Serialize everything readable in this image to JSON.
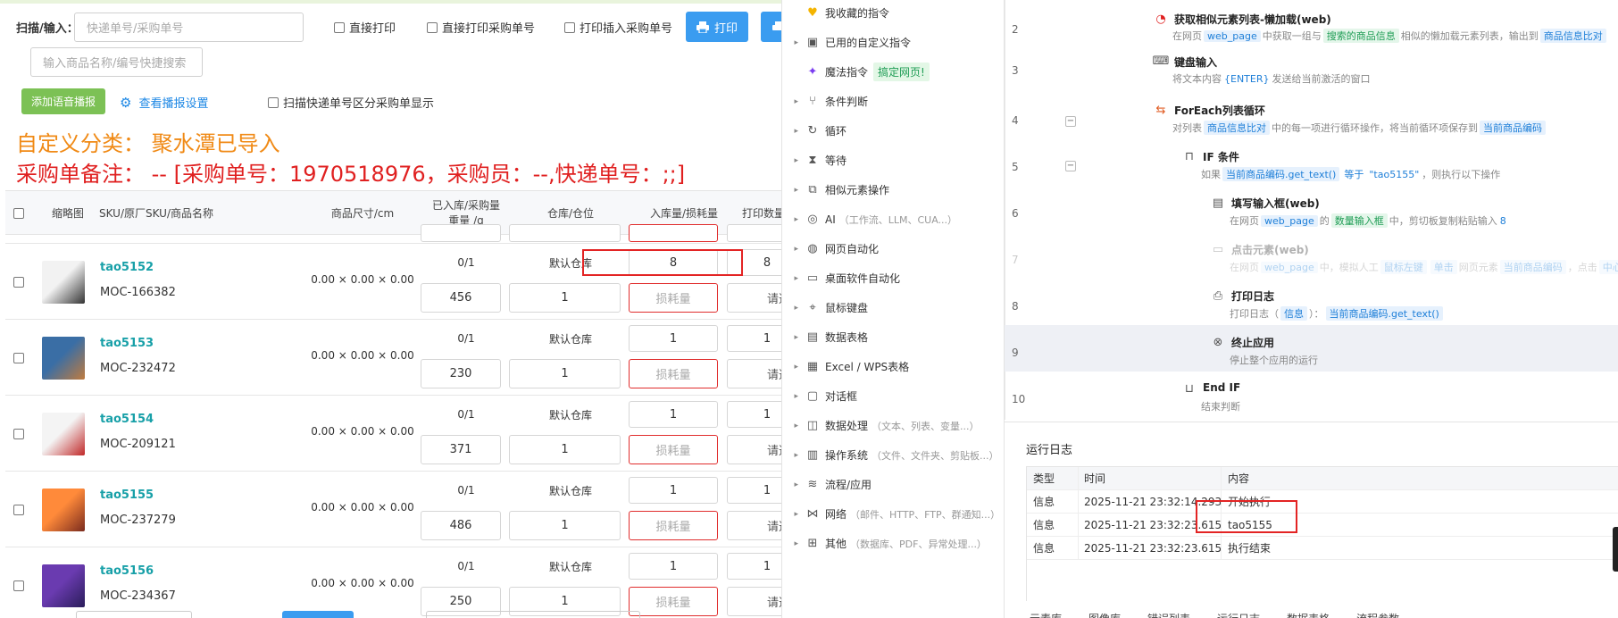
{
  "left": {
    "scan_label": "扫描/输入：",
    "scan_placeholder": "快递单号/采购单号",
    "options": [
      "直接打印",
      "直接打印采购单号",
      "打印插入采购单号"
    ],
    "print_button": "打印",
    "product_search_placeholder": "输入商品名称/编号快捷搜索",
    "voice_button": "添加语音播报",
    "voice_settings_link": "查看播报设置",
    "split_option": "扫描快递单号区分采购单显示",
    "category_line": "自定义分类： 聚水潭已导入",
    "remark_line": "采购单备注： -- [采购单号：1970518976，采购员：--,快递单号：;;]",
    "columns": [
      "缩略图",
      "SKU/原厂SKU/商品名称",
      "商品尺寸/cm",
      "已入库/采购量",
      "重量 /g",
      "仓库/仓位",
      "入库量/损耗量",
      "打印数量"
    ],
    "loss_placeholder": "损耗量",
    "print_select": "请选",
    "rows": [
      {
        "sku": "tao5152",
        "moc": "MOC-166382",
        "size": "0.00 × 0.00 × 0.00",
        "stock": "0/1",
        "weight": "456",
        "warehouse": "默认仓库",
        "pos": "1",
        "qty": "8",
        "print": "8"
      },
      {
        "sku": "tao5153",
        "moc": "MOC-232472",
        "size": "0.00 × 0.00 × 0.00",
        "stock": "0/1",
        "weight": "230",
        "warehouse": "默认仓库",
        "pos": "1",
        "qty": "1",
        "print": "1"
      },
      {
        "sku": "tao5154",
        "moc": "MOC-209121",
        "size": "0.00 × 0.00 × 0.00",
        "stock": "0/1",
        "weight": "371",
        "warehouse": "默认仓库",
        "pos": "1",
        "qty": "1",
        "print": "1"
      },
      {
        "sku": "tao5155",
        "moc": "MOC-237279",
        "size": "0.00 × 0.00 × 0.00",
        "stock": "0/1",
        "weight": "486",
        "warehouse": "默认仓库",
        "pos": "1",
        "qty": "1",
        "print": "1"
      },
      {
        "sku": "tao5156",
        "moc": "MOC-234367",
        "size": "0.00 × 0.00 × 0.00",
        "stock": "0/1",
        "weight": "250",
        "warehouse": "默认仓库",
        "pos": "1",
        "qty": "1",
        "print": "1"
      }
    ]
  },
  "commands": {
    "items": [
      {
        "label": "我收藏的指令",
        "icon": "heart-icon",
        "sub": "",
        "badge": "",
        "arrow": false
      },
      {
        "label": "已用的自定义指令",
        "icon": "custom-icon",
        "sub": "",
        "badge": "",
        "arrow": true
      },
      {
        "label": "魔法指令",
        "icon": "magic-icon",
        "sub": "",
        "badge": "搞定网页!",
        "arrow": false
      },
      {
        "label": "条件判断",
        "icon": "branch-icon",
        "sub": "",
        "badge": "",
        "arrow": true
      },
      {
        "label": "循环",
        "icon": "loop-icon",
        "sub": "",
        "badge": "",
        "arrow": true
      },
      {
        "label": "等待",
        "icon": "hourglass-icon",
        "sub": "",
        "badge": "",
        "arrow": true
      },
      {
        "label": "相似元素操作",
        "icon": "similar-icon",
        "sub": "",
        "badge": "",
        "arrow": true
      },
      {
        "label": "AI",
        "icon": "ai-icon",
        "sub": "（工作流、LLM、CUA...）",
        "badge": "",
        "arrow": true
      },
      {
        "label": "网页自动化",
        "icon": "globe-icon",
        "sub": "",
        "badge": "",
        "arrow": true
      },
      {
        "label": "桌面软件自动化",
        "icon": "monitor-icon",
        "sub": "",
        "badge": "",
        "arrow": true
      },
      {
        "label": "鼠标键盘",
        "icon": "mouse-icon",
        "sub": "",
        "badge": "",
        "arrow": true
      },
      {
        "label": "数据表格",
        "icon": "table-icon",
        "sub": "",
        "badge": "",
        "arrow": true
      },
      {
        "label": "Excel / WPS表格",
        "icon": "excel-icon",
        "sub": "",
        "badge": "",
        "arrow": true
      },
      {
        "label": "对话框",
        "icon": "dialog-icon",
        "sub": "",
        "badge": "",
        "arrow": true
      },
      {
        "label": "数据处理",
        "icon": "data-icon",
        "sub": "（文本、列表、变量...）",
        "badge": "",
        "arrow": true
      },
      {
        "label": "操作系统",
        "icon": "os-icon",
        "sub": "（文件、文件夹、剪贴板...）",
        "badge": "",
        "arrow": true
      },
      {
        "label": "流程/应用",
        "icon": "layers-icon",
        "sub": "",
        "badge": "",
        "arrow": true
      },
      {
        "label": "网络",
        "icon": "network-icon",
        "sub": "（邮件、HTTP、FTP、群通知...）",
        "badge": "",
        "arrow": true
      },
      {
        "label": "其他",
        "icon": "grid-icon",
        "sub": "（数据库、PDF、异常处理...）",
        "badge": "",
        "arrow": true
      }
    ]
  },
  "flow": {
    "steps": [
      {
        "line": "2",
        "title": "获取相似元素列表-懒加载(web)",
        "desc": [
          "在网页",
          "web_page",
          "中获取一组与",
          "搜索的商品信息",
          "相似的懒加载元素列表，输出到",
          "商品信息比对"
        ]
      },
      {
        "line": "3",
        "title": "键盘输入",
        "desc": [
          "将文本内容",
          "{ENTER}",
          "发送给当前激活的窗口"
        ]
      },
      {
        "line": "4",
        "title": "ForEach列表循环",
        "desc": [
          "对列表",
          "商品信息比对",
          "中的每一项进行循环操作，将当前循环项保存到",
          "当前商品编码"
        ]
      },
      {
        "line": "5",
        "title": "IF 条件",
        "desc": [
          "如果",
          "当前商品编码.get_text()",
          "等于",
          "\"tao5155\"",
          "，则执行以下操作"
        ]
      },
      {
        "line": "6",
        "title": "填写输入框(web)",
        "desc": [
          "在网页",
          "web_page",
          "的",
          "数量输入框",
          "中，剪切板复制粘贴输入",
          "8"
        ]
      },
      {
        "line": "7",
        "title": "点击元素(web)",
        "desc": [
          "在网页",
          "web_page",
          "中，模拟人工",
          "鼠标左键",
          "单击",
          "网页元素",
          "当前商品编码",
          "，点击",
          "中心点"
        ]
      },
      {
        "line": "8",
        "title": "打印日志",
        "desc": [
          "打印日志（",
          "信息",
          "）：",
          "当前商品编码.get_text()"
        ]
      },
      {
        "line": "9",
        "title": "终止应用",
        "desc": [
          "停止整个应用的运行"
        ]
      },
      {
        "line": "10",
        "title": "End IF",
        "desc": [
          "结束判断"
        ]
      }
    ],
    "log_title": "运行日志",
    "log_columns": [
      "类型",
      "时间",
      "内容"
    ],
    "log_rows": [
      {
        "type": "信息",
        "time": "2025-11-21 23:32:14.293",
        "content": "开始执行"
      },
      {
        "type": "信息",
        "time": "2025-11-21 23:32:23.615",
        "content": "tao5155"
      },
      {
        "type": "信息",
        "time": "2025-11-21 23:32:23.615",
        "content": "执行结束"
      }
    ],
    "bottom_tabs": [
      "元素库",
      "图像库",
      "错误列表",
      "运行日志",
      "数据表格",
      "流程参数"
    ]
  }
}
